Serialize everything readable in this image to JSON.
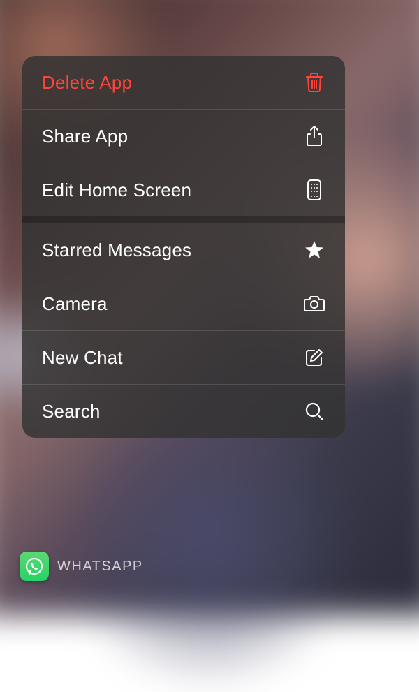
{
  "menu": {
    "items": [
      {
        "label": "Delete App",
        "icon": "trash-icon",
        "destructive": true
      },
      {
        "label": "Share App",
        "icon": "share-icon"
      },
      {
        "label": "Edit Home Screen",
        "icon": "home-screen-icon"
      },
      {
        "label": "Starred Messages",
        "icon": "star-icon"
      },
      {
        "label": "Camera",
        "icon": "camera-icon"
      },
      {
        "label": "New Chat",
        "icon": "compose-icon"
      },
      {
        "label": "Search",
        "icon": "search-icon"
      }
    ]
  },
  "app": {
    "name": "WHATSAPP",
    "icon": "whatsapp-icon"
  },
  "colors": {
    "destructive": "#ff453a",
    "whatsapp": "#25d366"
  }
}
